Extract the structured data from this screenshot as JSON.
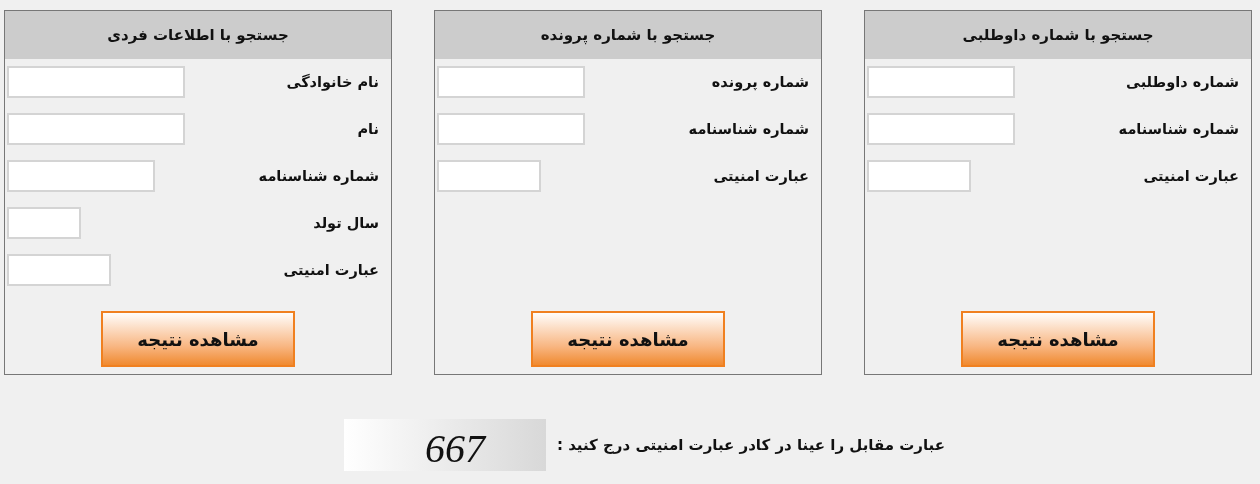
{
  "panels": [
    {
      "title": "جستجو با شماره داوطلبی",
      "fields": [
        {
          "label": "شماره داوطلبی",
          "kind": "medium"
        },
        {
          "label": "شماره شناسنامه",
          "kind": "medium"
        },
        {
          "label": "عبارت امنیتی",
          "kind": "short"
        }
      ],
      "button": "مشاهده نتیجه"
    },
    {
      "title": "جستجو با شماره پرونده",
      "fields": [
        {
          "label": "شماره پرونده",
          "kind": "medium"
        },
        {
          "label": "شماره شناسنامه",
          "kind": "medium"
        },
        {
          "label": "عبارت امنیتی",
          "kind": "short"
        }
      ],
      "button": "مشاهده نتیجه"
    },
    {
      "title": "جستجو با اطلاعات فردی",
      "fields": [
        {
          "label": "نام خانوادگی",
          "kind": "wide"
        },
        {
          "label": "نام",
          "kind": "wide"
        },
        {
          "label": "شماره شناسنامه",
          "kind": "medium"
        },
        {
          "label": "سال تولد",
          "kind": "tiny"
        },
        {
          "label": "عبارت امنیتی",
          "kind": "short"
        }
      ],
      "button": "مشاهده نتیجه"
    }
  ],
  "captcha": {
    "instruction": "عبارت مقابل را عینا در کادر عبارت امنیتی درج کنید :",
    "code": "667"
  }
}
